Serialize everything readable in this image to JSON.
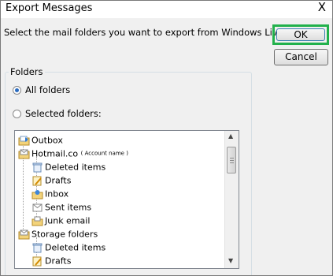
{
  "window": {
    "title": "Export Messages",
    "close_glyph": "X"
  },
  "instruction": "Select the mail folders you want to export from Windows Live Mail.",
  "buttons": {
    "ok": "OK",
    "cancel": "Cancel"
  },
  "group": {
    "label": "Folders"
  },
  "options": {
    "all": "All folders",
    "selected": "Selected folders:"
  },
  "tree": {
    "outbox": "Outbox",
    "hotmail": "Hotmail.co",
    "account_name": "( Account name )",
    "hotmail_children": [
      "Deleted items",
      "Drafts",
      "Inbox",
      "Sent items",
      "Junk email"
    ],
    "storage": "Storage folders",
    "storage_children": [
      "Deleted items",
      "Drafts"
    ]
  },
  "colors": {
    "highlight_green": "#22b14c",
    "folder_yellow": "#f3d37a"
  }
}
